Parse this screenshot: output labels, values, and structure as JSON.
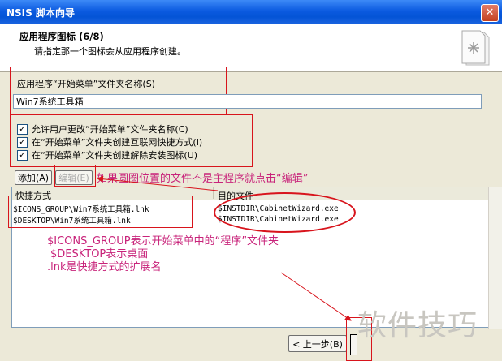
{
  "window": {
    "title": "NSIS 脚本向导",
    "close_symbol": "✕"
  },
  "header": {
    "step_title": "应用程序图标 (6/8)",
    "step_desc": "请指定那一个图标会从应用程序创建。",
    "icon": "document-gear-icon"
  },
  "folder": {
    "label": "应用程序“开始菜单”文件夹名称(S)",
    "value": "Win7系统工具箱"
  },
  "options": [
    {
      "label": "允许用户更改“开始菜单”文件夹名称(C)",
      "checked": true
    },
    {
      "label": "在“开始菜单”文件夹创建互联网快捷方式(I)",
      "checked": true
    },
    {
      "label": "在“开始菜单”文件夹创建解除安装图标(U)",
      "checked": true
    }
  ],
  "buttons": {
    "add": "添加(A)",
    "edit": "编辑(E)",
    "back": "< 上一步(B)"
  },
  "annotation_edit": "如果圆圈位置的文件不是主程序就点击“编辑”",
  "table": {
    "col_shortcut": "快捷方式",
    "col_target": "目的文件",
    "rows": [
      {
        "shortcut": "$ICONS_GROUP\\Win7系统工具箱.lnk",
        "target": "$INSTDIR\\CabinetWizard.exe"
      },
      {
        "shortcut": "$DESKTOP\\Win7系统工具箱.lnk",
        "target": "$INSTDIR\\CabinetWizard.exe"
      }
    ]
  },
  "annotation_lines": [
    "$ICONS_GROUP表示开始菜单中的“程序”文件夹",
    "$DESKTOP表示桌面",
    ".lnk是快捷方式的扩展名"
  ],
  "watermark": "软件技巧",
  "colors": {
    "annotation": "#d8141c",
    "annotation_text": "#c8237a",
    "title_bar": "#0b5ae0"
  }
}
